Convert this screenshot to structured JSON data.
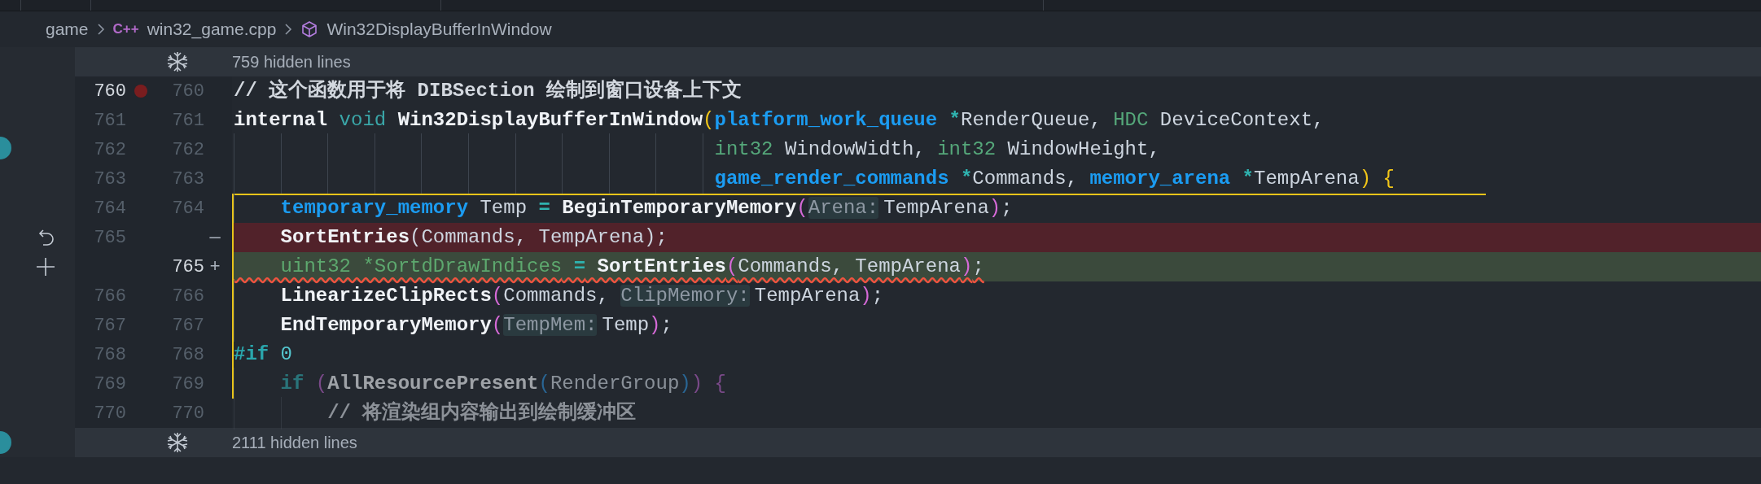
{
  "breadcrumbs": [
    {
      "text": "game",
      "kind": "folder"
    },
    {
      "text": "win32_game.cpp",
      "kind": "file",
      "icon_text": "C++"
    },
    {
      "text": "Win32DisplayBufferInWindow",
      "kind": "symbol"
    }
  ],
  "rows": [
    {
      "kind": "hidden",
      "text": "759 hidden lines"
    },
    {
      "kind": "context",
      "old": "760",
      "new": "760",
      "breakpoint": true,
      "current": true,
      "in_scope": false,
      "dimmed": false,
      "error": false,
      "tokens": [
        {
          "text": "// 这个函数用于将 DIBSection 绘制到窗口设备上下文",
          "kind": "comment"
        }
      ]
    },
    {
      "kind": "context",
      "old": "761",
      "new": "761",
      "current": false,
      "in_scope": false,
      "dimmed": false,
      "error": false,
      "tokens": [
        {
          "text": "internal",
          "kind": "keyword"
        },
        {
          "text": " void",
          "kind": "builtin"
        },
        {
          "text": " Win32DisplayBufferInWindow",
          "kind": "func"
        },
        {
          "text": "(",
          "kind": "bracket_yellow"
        },
        {
          "text": "platform_work_queue",
          "kind": "user_type"
        },
        {
          "text": " *",
          "kind": "op"
        },
        {
          "text": "RenderQueue, ",
          "kind": "ident"
        },
        {
          "text": "HDC",
          "kind": "builtin_type"
        },
        {
          "text": " DeviceContext,",
          "kind": "ident"
        }
      ]
    },
    {
      "kind": "context",
      "old": "762",
      "new": "762",
      "current": false,
      "in_scope": false,
      "dimmed": false,
      "error": false,
      "tokens": [
        {
          "text": "                                         int32",
          "kind": "builtin_type"
        },
        {
          "text": " WindowWidth, ",
          "kind": "ident"
        },
        {
          "text": "int32",
          "kind": "builtin_type"
        },
        {
          "text": " WindowHeight,",
          "kind": "ident"
        }
      ]
    },
    {
      "kind": "context",
      "old": "763",
      "new": "763",
      "current": false,
      "in_scope": false,
      "dimmed": false,
      "error": false,
      "tokens": [
        {
          "text": "                                         game_render_commands",
          "kind": "user_type"
        },
        {
          "text": " *",
          "kind": "op"
        },
        {
          "text": "Commands, ",
          "kind": "ident"
        },
        {
          "text": "memory_arena",
          "kind": "user_type"
        },
        {
          "text": " *",
          "kind": "op"
        },
        {
          "text": "TempArena",
          "kind": "ident"
        },
        {
          "text": ")",
          "kind": "bracket_yellow"
        },
        {
          "text": " {",
          "kind": "bracket_yellow"
        }
      ]
    },
    {
      "kind": "context",
      "old": "764",
      "new": "764",
      "current": false,
      "in_scope": true,
      "dimmed": false,
      "error": false,
      "tokens": [
        {
          "text": "    temporary_memory",
          "kind": "user_type"
        },
        {
          "text": " Temp ",
          "kind": "ident"
        },
        {
          "text": "=",
          "kind": "op"
        },
        {
          "text": " BeginTemporaryMemory",
          "kind": "func"
        },
        {
          "text": "(",
          "kind": "bracket_pink"
        },
        {
          "text": "Arena:",
          "kind": "hint"
        },
        {
          "text": "TempArena",
          "kind": "ident"
        },
        {
          "text": ")",
          "kind": "bracket_pink"
        },
        {
          "text": ";",
          "kind": "ident"
        }
      ]
    },
    {
      "kind": "removed",
      "old": "765",
      "sign": "—",
      "current": false,
      "in_scope": true,
      "dimmed": false,
      "error": false,
      "tokens": [
        {
          "text": "    SortEntries",
          "kind": "func"
        },
        {
          "text": "(Commands, TempArena);",
          "kind": "ident"
        }
      ]
    },
    {
      "kind": "added",
      "new": "765",
      "sign": "+",
      "current": true,
      "in_scope": true,
      "dimmed": false,
      "error": true,
      "tokens": [
        {
          "text": "    uint32 *SortdDrawIndices",
          "kind": "unused"
        },
        {
          "text": " =",
          "kind": "op"
        },
        {
          "text": " SortEntries",
          "kind": "func"
        },
        {
          "text": "(",
          "kind": "bracket_pink"
        },
        {
          "text": "Commands, TempArena",
          "kind": "ident"
        },
        {
          "text": ")",
          "kind": "bracket_pink"
        },
        {
          "text": ";",
          "kind": "ident"
        }
      ]
    },
    {
      "kind": "context",
      "old": "766",
      "new": "766",
      "current": false,
      "in_scope": true,
      "dimmed": false,
      "error": false,
      "tokens": [
        {
          "text": "    LinearizeClipRects",
          "kind": "func"
        },
        {
          "text": "(",
          "kind": "bracket_pink"
        },
        {
          "text": "Commands, ",
          "kind": "ident"
        },
        {
          "text": "ClipMemory:",
          "kind": "hint"
        },
        {
          "text": "TempArena",
          "kind": "ident"
        },
        {
          "text": ")",
          "kind": "bracket_pink"
        },
        {
          "text": ";",
          "kind": "ident"
        }
      ]
    },
    {
      "kind": "context",
      "old": "767",
      "new": "767",
      "current": false,
      "in_scope": true,
      "dimmed": false,
      "error": false,
      "tokens": [
        {
          "text": "    EndTemporaryMemory",
          "kind": "func"
        },
        {
          "text": "(",
          "kind": "bracket_pink"
        },
        {
          "text": "TempMem:",
          "kind": "hint"
        },
        {
          "text": "Temp",
          "kind": "ident"
        },
        {
          "text": ")",
          "kind": "bracket_pink"
        },
        {
          "text": ";",
          "kind": "ident"
        }
      ]
    },
    {
      "kind": "context",
      "old": "768",
      "new": "768",
      "current": false,
      "in_scope": true,
      "dimmed": false,
      "error": false,
      "tokens": [
        {
          "text": "#if",
          "kind": "preproc"
        },
        {
          "text": " 0",
          "kind": "number"
        }
      ]
    },
    {
      "kind": "context",
      "old": "769",
      "new": "769",
      "current": false,
      "in_scope": true,
      "dimmed": true,
      "error": false,
      "tokens": [
        {
          "text": "    if",
          "kind": "control"
        },
        {
          "text": " (",
          "kind": "bracket_purple"
        },
        {
          "text": "AllResourcePresent",
          "kind": "func"
        },
        {
          "text": "(",
          "kind": "bracket_blue"
        },
        {
          "text": "RenderGroup",
          "kind": "ident"
        },
        {
          "text": ")",
          "kind": "bracket_blue"
        },
        {
          "text": ")",
          "kind": "bracket_purple"
        },
        {
          "text": " {",
          "kind": "bracket_purple"
        }
      ]
    },
    {
      "kind": "context",
      "old": "770",
      "new": "770",
      "current": false,
      "in_scope": false,
      "dimmed": true,
      "error": false,
      "tokens": [
        {
          "text": "        // 将渲染组内容输出到绘制缓冲区",
          "kind": "comment"
        }
      ]
    },
    {
      "kind": "hidden",
      "text": "2111 hidden lines"
    }
  ]
}
